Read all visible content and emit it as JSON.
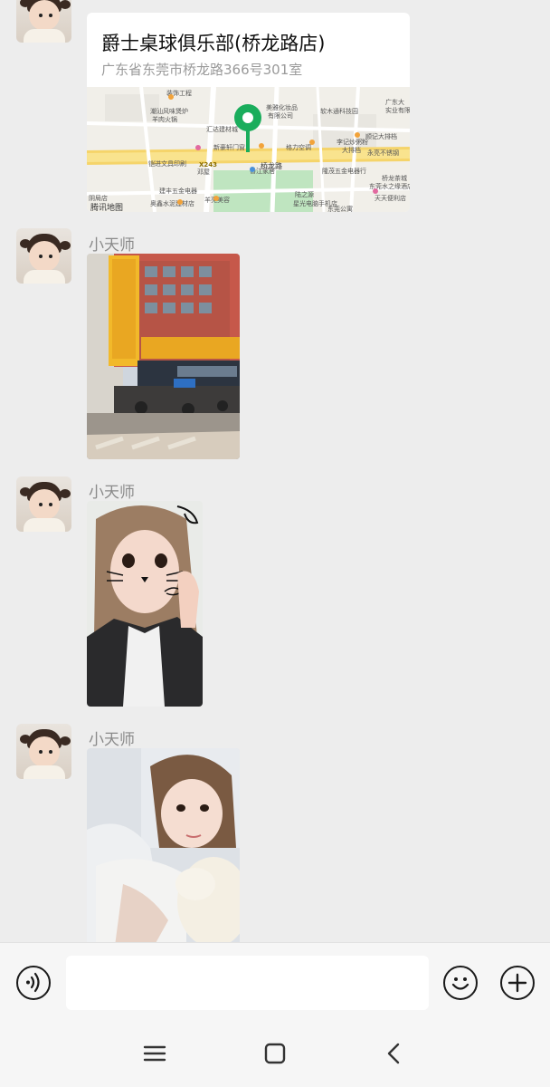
{
  "messages": [
    {
      "type": "location",
      "title": "爵士桌球俱乐部(桥龙路店)",
      "address": "广东省东莞市桥龙路366号301室",
      "map": {
        "road_label": "桥龙路",
        "highway_label": "X243",
        "provider": "腾讯地图",
        "labels": [
          "装饰工程",
          "潮汕风味煲炉",
          "羊肉火锅",
          "汇达建材城",
          "美雅化妆品",
          "有限公司",
          "软木通科技园",
          "广东大",
          "实业有限",
          "新豪轩门窗",
          "格力空调",
          "李记炒粥粉",
          "大排档",
          "顺记大排档",
          "永亮不锈钢",
          "东莞水之缘酒店",
          "铠进文具印刷",
          "邓屋",
          "香江家居",
          "隆茂五金电器行",
          "桥龙茶城",
          "建丰五金电器",
          "羊亮美容",
          "陆之源",
          "天天便利店",
          "奥鑫水泥建材店",
          "星光电脑手机店",
          "东莞公寓",
          "阴局店"
        ]
      }
    },
    {
      "type": "image",
      "sender": "小天师",
      "image_desc": "storefront-building"
    },
    {
      "type": "image",
      "sender": "小天师",
      "image_desc": "girl-selfie-cat-filter"
    },
    {
      "type": "image",
      "sender": "小天师",
      "image_desc": "girl-selfie-lying"
    }
  ],
  "input": {
    "placeholder": ""
  },
  "icons": {
    "voice": "voice-icon",
    "emoji": "emoji-icon",
    "plus": "plus-icon",
    "nav_menu": "menu-icon",
    "nav_home": "home-icon",
    "nav_back": "back-icon"
  },
  "colors": {
    "background": "#ededed",
    "map_pin": "#1aad5c",
    "sender_name": "#8a8a8a"
  }
}
